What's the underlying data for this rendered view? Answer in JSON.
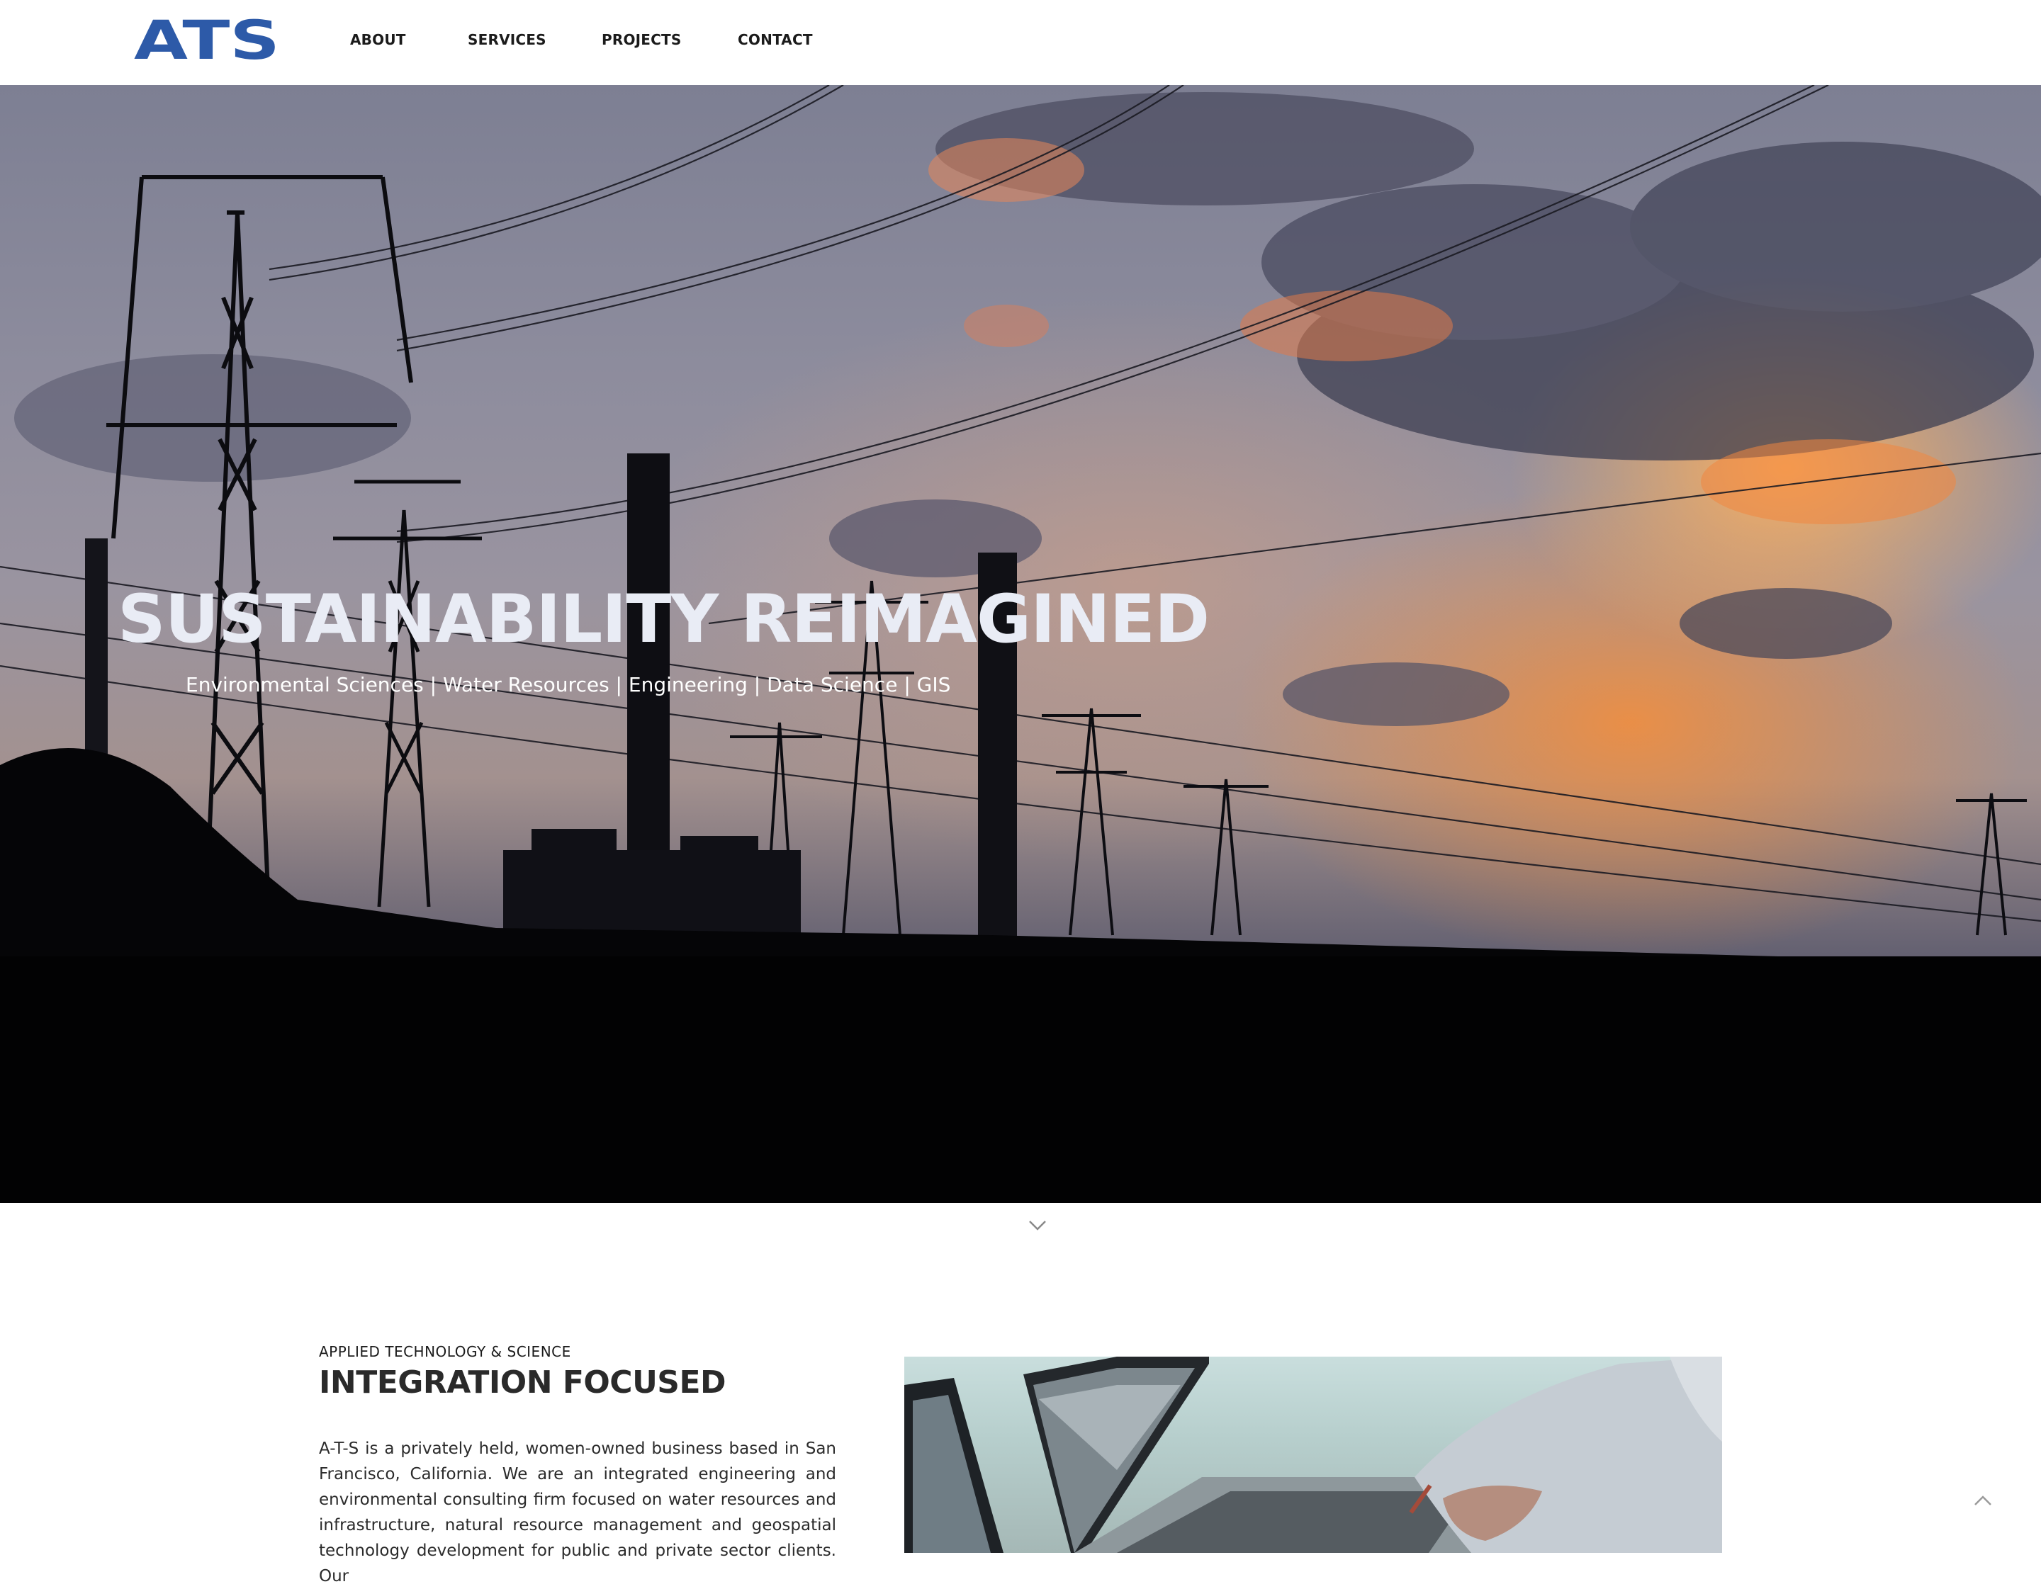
{
  "brand": {
    "logo_text": "ATS",
    "color": "#2d5aa8"
  },
  "nav": {
    "items": [
      {
        "label": "ABOUT"
      },
      {
        "label": "SERVICES"
      },
      {
        "label": "PROJECTS"
      },
      {
        "label": "CONTACT"
      }
    ]
  },
  "hero": {
    "title": "SUSTAINABILITY REIMAGINED",
    "subtitle": "Environmental Sciences | Water Resources | Engineering | Data Science | GIS"
  },
  "about": {
    "eyebrow": "APPLIED TECHNOLOGY & SCIENCE",
    "heading": "INTEGRATION FOCUSED",
    "body": "A-T-S is a privately held, women-owned business based in San Francisco, California. We are an integrated engineering and environmental consulting firm focused on water resources and infrastructure, natural resource management and geospatial technology development for public and private sector clients. Our"
  },
  "icons": {
    "scroll_down": "chevron-down-icon",
    "back_to_top": "chevron-up-icon"
  }
}
